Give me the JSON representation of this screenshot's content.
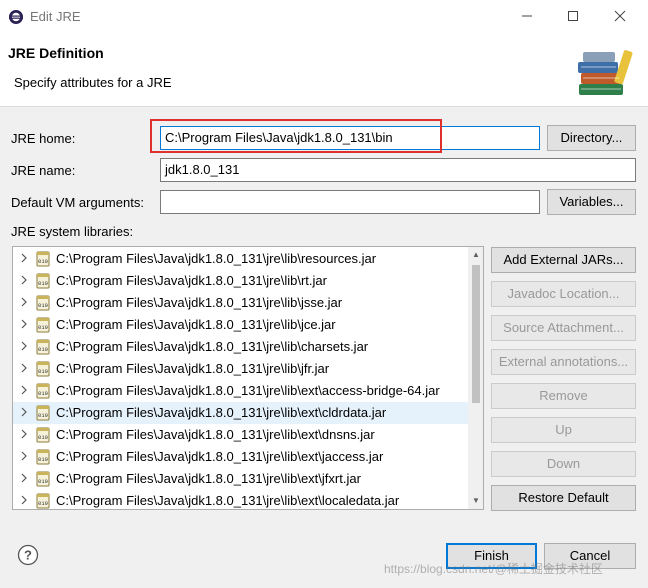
{
  "window": {
    "title": "Edit JRE"
  },
  "header": {
    "title": "JRE Definition",
    "subtitle": "Specify attributes for a JRE"
  },
  "form": {
    "jre_home_label": "JRE home:",
    "jre_home_value": "C:\\Program Files\\Java\\jdk1.8.0_131\\bin",
    "jre_name_label": "JRE name:",
    "jre_name_value": "jdk1.8.0_131",
    "vm_args_label": "Default VM arguments:",
    "vm_args_value": "",
    "directory_button": "Directory...",
    "variables_button": "Variables...",
    "libraries_label": "JRE system libraries:"
  },
  "libraries": [
    "C:\\Program Files\\Java\\jdk1.8.0_131\\jre\\lib\\resources.jar",
    "C:\\Program Files\\Java\\jdk1.8.0_131\\jre\\lib\\rt.jar",
    "C:\\Program Files\\Java\\jdk1.8.0_131\\jre\\lib\\jsse.jar",
    "C:\\Program Files\\Java\\jdk1.8.0_131\\jre\\lib\\jce.jar",
    "C:\\Program Files\\Java\\jdk1.8.0_131\\jre\\lib\\charsets.jar",
    "C:\\Program Files\\Java\\jdk1.8.0_131\\jre\\lib\\jfr.jar",
    "C:\\Program Files\\Java\\jdk1.8.0_131\\jre\\lib\\ext\\access-bridge-64.jar",
    "C:\\Program Files\\Java\\jdk1.8.0_131\\jre\\lib\\ext\\cldrdata.jar",
    "C:\\Program Files\\Java\\jdk1.8.0_131\\jre\\lib\\ext\\dnsns.jar",
    "C:\\Program Files\\Java\\jdk1.8.0_131\\jre\\lib\\ext\\jaccess.jar",
    "C:\\Program Files\\Java\\jdk1.8.0_131\\jre\\lib\\ext\\jfxrt.jar",
    "C:\\Program Files\\Java\\jdk1.8.0_131\\jre\\lib\\ext\\localedata.jar"
  ],
  "selected_library_index": 7,
  "side_buttons": {
    "add_external_jars": "Add External JARs...",
    "javadoc_location": "Javadoc Location...",
    "source_attachment": "Source Attachment...",
    "external_annotations": "External annotations...",
    "remove": "Remove",
    "up": "Up",
    "down": "Down",
    "restore_default": "Restore Default"
  },
  "footer": {
    "finish": "Finish",
    "cancel": "Cancel",
    "watermark": "https://blog.csdn.net/@稀土掘金技术社区"
  },
  "colors": {
    "highlight": "#e0302e",
    "focus_border": "#0078d7",
    "selection": "#e5f1fb"
  },
  "icons": [
    "eclipse-icon",
    "minimize-icon",
    "maximize-icon",
    "close-icon",
    "books-icon",
    "jar-icon",
    "chevron-right-icon",
    "help-icon"
  ]
}
